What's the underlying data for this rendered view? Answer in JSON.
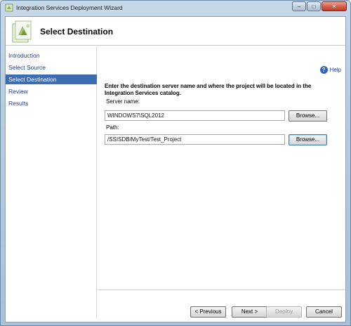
{
  "window": {
    "title": "Integration Services Deployment Wizard",
    "controls": {
      "minimize": "–",
      "maximize": "□",
      "close": "✕"
    }
  },
  "header": {
    "title": "Select Destination"
  },
  "nav": {
    "items": [
      {
        "label": "Introduction",
        "active": false
      },
      {
        "label": "Select Source",
        "active": false
      },
      {
        "label": "Select Destination",
        "active": true
      },
      {
        "label": "Review",
        "active": false
      },
      {
        "label": "Results",
        "active": false
      }
    ]
  },
  "help": {
    "label": "Help"
  },
  "main": {
    "instructions": "Enter the destination server name and where the project will be located in the Integration Services catalog.",
    "server_name": {
      "label": "Server name:",
      "value": "WINDOWS7\\SQL2012",
      "browse_label": "Browse..."
    },
    "path": {
      "label": "Path:",
      "value": "/SSISDB/MyTest/Test_Project",
      "browse_label": "Browse..."
    }
  },
  "footer": {
    "previous": "< Previous",
    "next": "Next >",
    "deploy": "Deploy",
    "cancel": "Cancel"
  },
  "colors": {
    "accent": "#3d6cb0",
    "link": "#1f3f8f",
    "close_button": "#c23b27"
  }
}
